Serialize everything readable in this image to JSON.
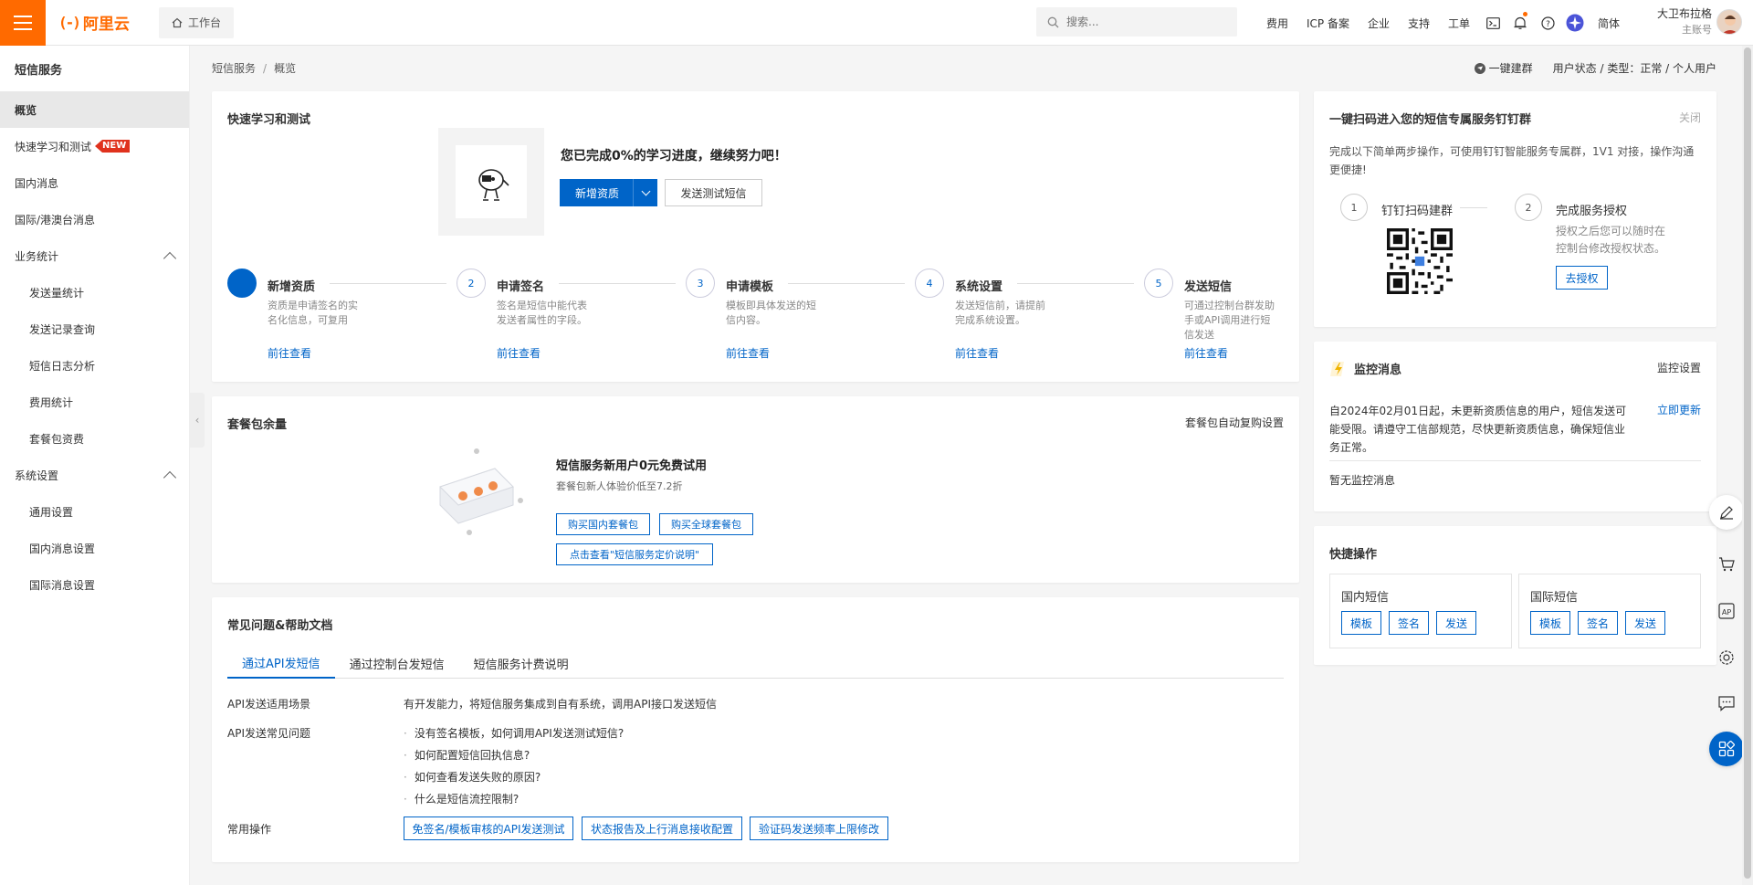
{
  "topbar": {
    "logo_text": "阿里云",
    "workbench": "工作台",
    "search_placeholder": "搜索...",
    "nav": [
      "费用",
      "ICP 备案",
      "企业",
      "支持",
      "工单"
    ],
    "lang": "简体",
    "user_name": "大卫布拉格",
    "user_role": "主账号",
    "brand_color": "#ff6a00"
  },
  "sidebar": {
    "title": "短信服务",
    "items": [
      {
        "label": "概览"
      },
      {
        "label": "快速学习和测试",
        "badge": "NEW"
      },
      {
        "label": "国内消息"
      },
      {
        "label": "国际/港澳台消息"
      },
      {
        "label": "业务统计"
      },
      {
        "label": "发送量统计"
      },
      {
        "label": "发送记录查询"
      },
      {
        "label": "短信日志分析"
      },
      {
        "label": "费用统计"
      },
      {
        "label": "套餐包资费"
      },
      {
        "label": "系统设置"
      },
      {
        "label": "通用设置"
      },
      {
        "label": "国内消息设置"
      },
      {
        "label": "国际消息设置"
      }
    ]
  },
  "breadcrumb": {
    "root": "短信服务",
    "sep": "/",
    "current": "概览"
  },
  "header_right": {
    "join_group": "一键建群",
    "status": "用户状态 / 类型：正常 / 个人用户"
  },
  "learn": {
    "title": "快速学习和测试",
    "progress_text": "您已完成0%的学习进度，继续努力吧！",
    "progress_percent": 0,
    "primary_btn": "新增资质",
    "test_btn": "发送测试短信",
    "steps": [
      {
        "num": "1",
        "name": "新增资质",
        "desc": "资质是申请签名的实名化信息，可复用",
        "link": "前往查看"
      },
      {
        "num": "2",
        "name": "申请签名",
        "desc": "签名是短信中能代表发送者属性的字段。",
        "link": "前往查看"
      },
      {
        "num": "3",
        "name": "申请模板",
        "desc": "模板即具体发送的短信内容。",
        "link": "前往查看"
      },
      {
        "num": "4",
        "name": "系统设置",
        "desc": "发送短信前，请提前完成系统设置。",
        "link": "前往查看"
      },
      {
        "num": "5",
        "name": "发送短信",
        "desc": "可通过控制台群发助手或API调用进行短信发送",
        "link": "前往查看"
      }
    ]
  },
  "package": {
    "title": "套餐包余量",
    "action": "套餐包自动复购设置",
    "promo_title": "短信服务新用户0元免费试用",
    "promo_sub": "套餐包新人体验价低至7.2折",
    "btn_domestic": "购买国内套餐包",
    "btn_global": "购买全球套餐包",
    "btn_pricing": "点击查看\"短信服务定价说明\""
  },
  "faq": {
    "title": "常见问题&帮助文档",
    "tabs": [
      "通过API发短信",
      "通过控制台发短信",
      "短信服务计费说明"
    ],
    "scene_label": "API发送适用场景",
    "scene_value": "有开发能力，将短信服务集成到自有系统，调用API接口发送短信",
    "questions_label": "API发送常见问题",
    "questions": [
      "没有签名模板，如何调用API发送测试短信?",
      "如何配置短信回执信息?",
      "如何查看发送失败的原因?",
      "什么是短信流控限制?"
    ],
    "ops_label": "常用操作",
    "ops": [
      "免签名/模板审核的API发送测试",
      "状态报告及上行消息接收配置",
      "验证码发送频率上限修改"
    ]
  },
  "dingtalk": {
    "title": "一键扫码进入您的短信专属服务钉钉群",
    "close": "关闭",
    "desc": "完成以下简单两步操作，可使用钉钉智能服务专属群，1V1 对接，操作沟通更便捷!",
    "step1_num": "1",
    "step1": "钉钉扫码建群",
    "step2_num": "2",
    "step2": "完成服务授权",
    "step2_desc": "授权之后您可以随时在控制台修改授权状态。",
    "auth_btn": "去授权"
  },
  "monitor": {
    "title": "监控消息",
    "settings": "监控设置",
    "notice": "自2024年02月01日起，未更新资质信息的用户，短信发送可能受限。请遵守工信部规范，尽快更新资质信息，确保短信业务正常。",
    "update_link": "立即更新",
    "empty": "暂无监控消息"
  },
  "quick": {
    "title": "快捷操作",
    "domestic": {
      "title": "国内短信",
      "btns": [
        "模板",
        "签名",
        "发送"
      ]
    },
    "global": {
      "title": "国际短信",
      "btns": [
        "模板",
        "签名",
        "发送"
      ]
    }
  }
}
